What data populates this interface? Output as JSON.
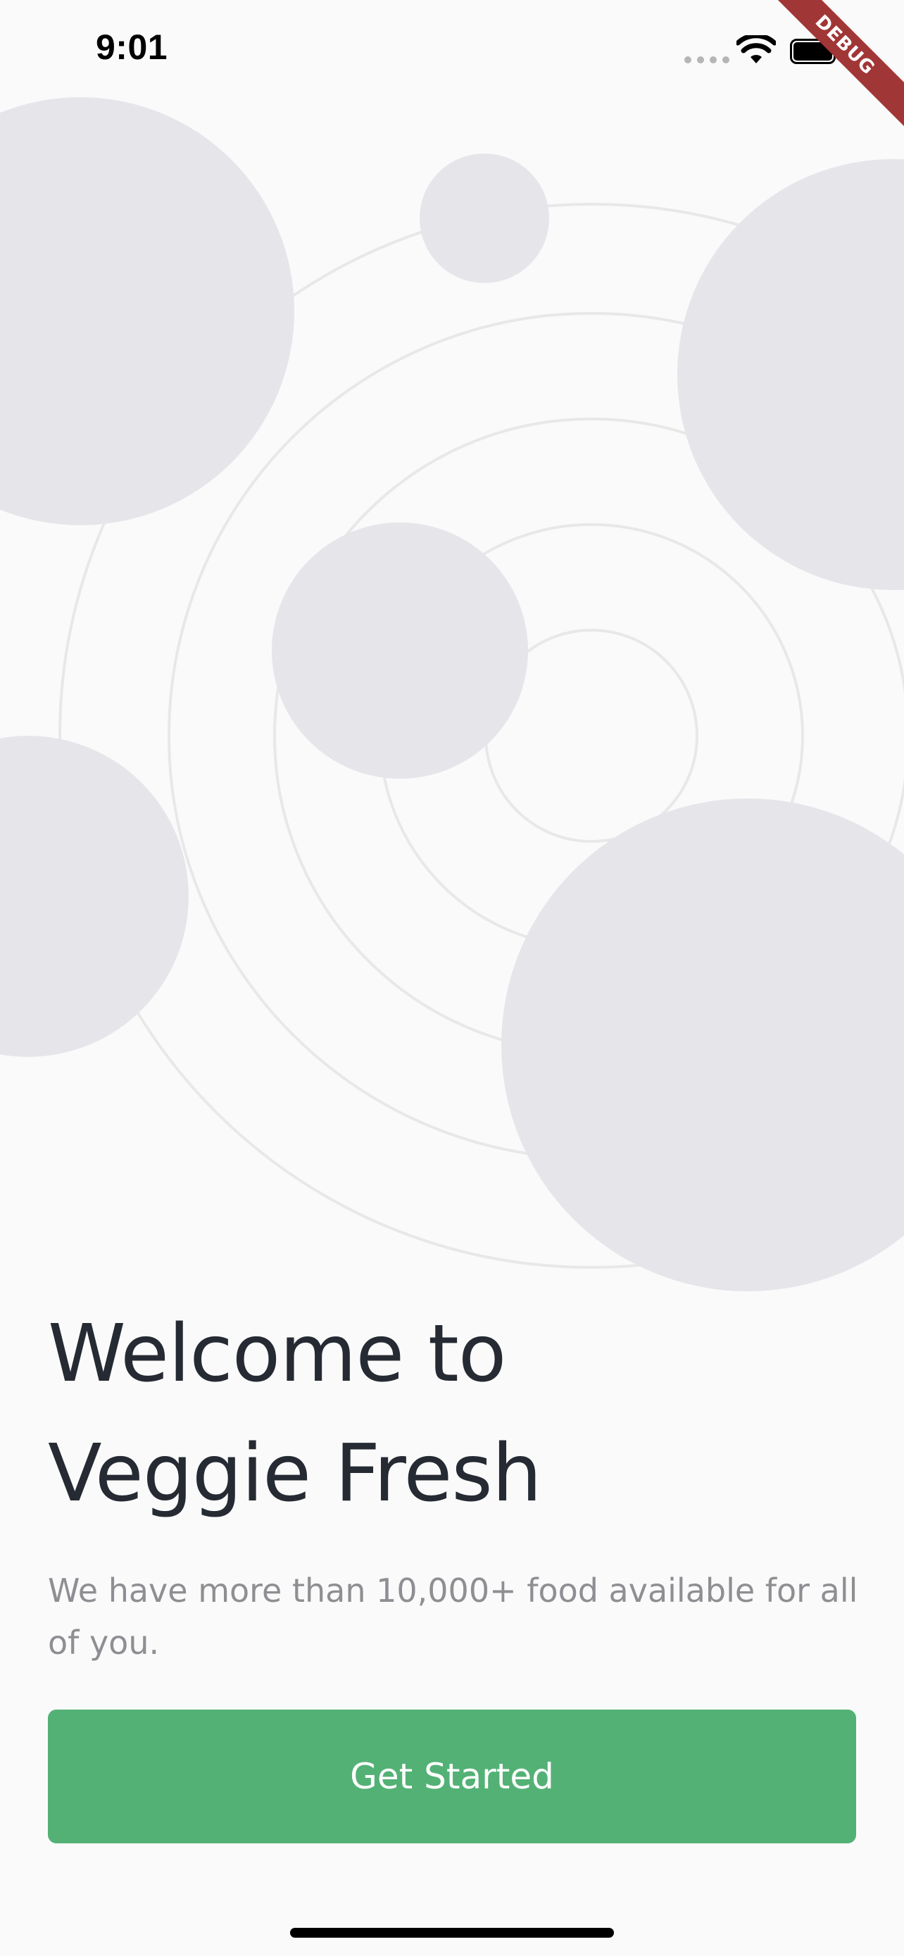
{
  "status_bar": {
    "time": "9:01",
    "signal_icon": "cellular-signal-dots",
    "wifi_icon": "wifi-icon",
    "battery_icon": "battery-full-icon"
  },
  "debug_banner": {
    "label": "DEBUG",
    "color": "#a13636"
  },
  "onboarding": {
    "title_line1": "Welcome to",
    "title_line2": "Veggie Fresh",
    "subtitle": "We have more than 10,000+ food available for all of you.",
    "button_label": "Get Started"
  },
  "colors": {
    "background": "#fafafa",
    "accent": "#53b175",
    "title_text": "#252a33",
    "subtitle_text": "#8e8e93",
    "illustration_circle": "#e6e5ea",
    "illustration_ring": "#e8e8e8"
  }
}
